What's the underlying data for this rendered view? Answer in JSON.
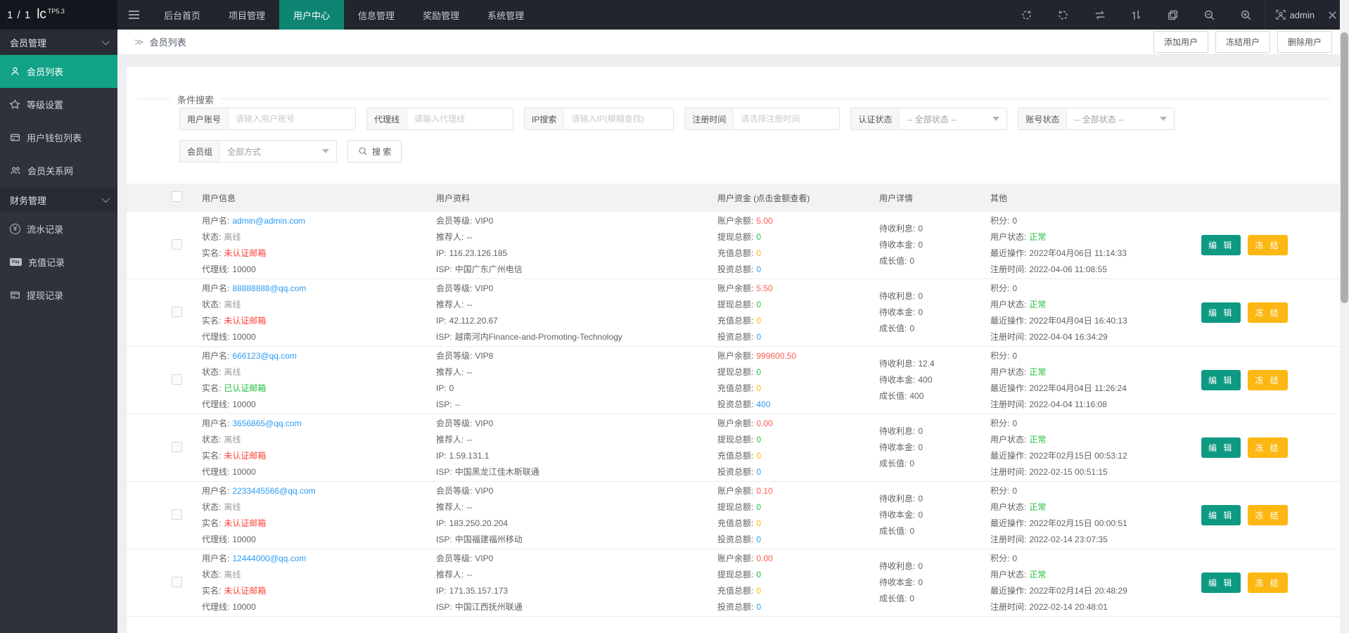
{
  "topbar": {
    "pager": "1 / 1",
    "logo": "lc",
    "logo_version": "TP5.3",
    "nav": [
      {
        "label": "后台首页"
      },
      {
        "label": "项目管理"
      },
      {
        "label": "用户中心"
      },
      {
        "label": "信息管理"
      },
      {
        "label": "奖励管理"
      },
      {
        "label": "系统管理"
      }
    ],
    "admin_label": "admin"
  },
  "sidebar": {
    "groups": [
      {
        "title": "会员管理",
        "items": [
          {
            "label": "会员列表"
          },
          {
            "label": "等级设置"
          },
          {
            "label": "用户钱包列表"
          },
          {
            "label": "会员关系网"
          }
        ]
      },
      {
        "title": "财务管理",
        "items": [
          {
            "label": "流水记录"
          },
          {
            "label": "充值记录"
          },
          {
            "label": "提现记录"
          }
        ]
      }
    ]
  },
  "breadcrumb": {
    "arrows": "≫",
    "title": "会员列表"
  },
  "page_actions": [
    {
      "label": "添加用户"
    },
    {
      "label": "冻结用户"
    },
    {
      "label": "删除用户"
    }
  ],
  "search": {
    "legend": "条件搜索",
    "fields": [
      {
        "label": "用户账号",
        "placeholder": "请输入用户账号"
      },
      {
        "label": "代理线",
        "placeholder": "请输入代理线"
      },
      {
        "label": "IP搜索",
        "placeholder": "请输入IP(模糊查找)"
      },
      {
        "label": "注册时间",
        "placeholder": "请选择注册时间"
      },
      {
        "label": "认证状态",
        "value": "-- 全部状态 --"
      },
      {
        "label": "账号状态",
        "value": "-- 全部状态 --"
      }
    ],
    "group_field": {
      "label": "会员组",
      "value": "全部方式"
    },
    "button_label": "搜 索"
  },
  "table": {
    "headers": [
      "用户信息",
      "用户资料",
      "用户资金 (点击金额查看)",
      "用户详情",
      "其他"
    ],
    "labels": {
      "username": "用户名:",
      "status": "状态:",
      "realname": "实名:",
      "agent": "代理线:",
      "level": "会员等级:",
      "referrer": "推荐人:",
      "ip": "IP:",
      "isp": "ISP:",
      "balance": "账户余额:",
      "withdraw": "提现总额:",
      "recharge": "充值总额:",
      "invest": "投资总额:",
      "interest": "待收利息:",
      "principal": "待收本金:",
      "growth": "成长值:",
      "points": "积分:",
      "user_status": "用户状态:",
      "last_op": "最近操作:",
      "reg_time": "注册时间:"
    },
    "row_actions": {
      "edit": "编 辑",
      "freeze": "冻 结"
    },
    "rows": [
      {
        "username": "admin@admin.com",
        "status": "离线",
        "realname": "未认证邮箱",
        "realname_class": "val-red",
        "agent": "10000",
        "level": "VIP0",
        "referrer": "--",
        "ip": "116.23.126.185",
        "isp": "中国广东广州电信",
        "balance": "5.00",
        "withdraw": "0",
        "recharge": "0",
        "invest": "0",
        "interest": "0",
        "principal": "0",
        "growth": "0",
        "points": "0",
        "user_status": "正常",
        "last_op": "2022年04月06日 11:14:33",
        "reg_time": "2022-04-06 11:08:55"
      },
      {
        "username": "88888888@qq.com",
        "status": "离线",
        "realname": "未认证邮箱",
        "realname_class": "val-red",
        "agent": "10000",
        "level": "VIP0",
        "referrer": "--",
        "ip": "42.112.20.67",
        "isp": "越南河内Finance-and-Promoting-Technology",
        "balance": "5.50",
        "withdraw": "0",
        "recharge": "0",
        "invest": "0",
        "interest": "0",
        "principal": "0",
        "growth": "0",
        "points": "0",
        "user_status": "正常",
        "last_op": "2022年04月04日 16:40:13",
        "reg_time": "2022-04-04 16:34:29"
      },
      {
        "username": "666123@qq.com",
        "status": "离线",
        "realname": "已认证邮箱",
        "realname_class": "val-green",
        "agent": "10000",
        "level": "VIP8",
        "referrer": "--",
        "ip": "0",
        "isp": "--",
        "balance": "999600.50",
        "withdraw": "0",
        "recharge": "0",
        "invest": "400",
        "interest": "12.4",
        "principal": "400",
        "growth": "400",
        "points": "0",
        "user_status": "正常",
        "last_op": "2022年04月04日 11:26:24",
        "reg_time": "2022-04-04 11:16:08"
      },
      {
        "username": "3656865@qq.com",
        "status": "离线",
        "realname": "未认证邮箱",
        "realname_class": "val-red",
        "agent": "10000",
        "level": "VIP0",
        "referrer": "--",
        "ip": "1.59.131.1",
        "isp": "中国黑龙江佳木斯联通",
        "balance": "0.00",
        "withdraw": "0",
        "recharge": "0",
        "invest": "0",
        "interest": "0",
        "principal": "0",
        "growth": "0",
        "points": "0",
        "user_status": "正常",
        "last_op": "2022年02月15日 00:53:12",
        "reg_time": "2022-02-15 00:51:15"
      },
      {
        "username": "2233445566@qq.com",
        "status": "离线",
        "realname": "未认证邮箱",
        "realname_class": "val-red",
        "agent": "10000",
        "level": "VIP0",
        "referrer": "--",
        "ip": "183.250.20.204",
        "isp": "中国福建福州移动",
        "balance": "0.10",
        "withdraw": "0",
        "recharge": "0",
        "invest": "0",
        "interest": "0",
        "principal": "0",
        "growth": "0",
        "points": "0",
        "user_status": "正常",
        "last_op": "2022年02月15日 00:00:51",
        "reg_time": "2022-02-14 23:07:35"
      },
      {
        "username": "12444000@qq.com",
        "status": "离线",
        "realname": "未认证邮箱",
        "realname_class": "val-red",
        "agent": "10000",
        "level": "VIP0",
        "referrer": "--",
        "ip": "171.35.157.173",
        "isp": "中国江西抚州联通",
        "balance": "0.00",
        "withdraw": "0",
        "recharge": "0",
        "invest": "0",
        "interest": "0",
        "principal": "0",
        "growth": "0",
        "points": "0",
        "user_status": "正常",
        "last_op": "2022年02月14日 20:48:29",
        "reg_time": "2022-02-14 20:48:01"
      }
    ]
  },
  "colors": {
    "topbar_active": "#0e8573",
    "sidebar_active": "#12a286",
    "link_blue": "#2d9cf4",
    "danger_red": "#fe4338",
    "success_green": "#21c03a",
    "balance_red": "#fb5d52",
    "recharge_orange": "#ffb800",
    "invest_blue": "#2b9cf2",
    "edit_teal": "#0e9a82",
    "freeze_yellow": "#fcb712"
  }
}
